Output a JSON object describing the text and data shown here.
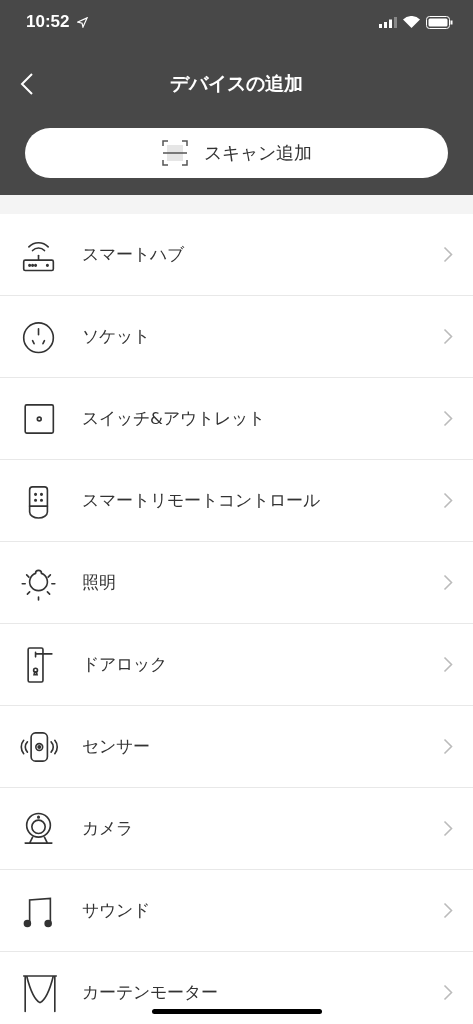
{
  "status_bar": {
    "time": "10:52"
  },
  "nav": {
    "title": "デバイスの追加"
  },
  "scan_button": {
    "label": "スキャン追加"
  },
  "items": [
    {
      "kind": "hub",
      "label": "スマートハブ"
    },
    {
      "kind": "socket",
      "label": "ソケット"
    },
    {
      "kind": "switch",
      "label": "スイッチ&アウトレット"
    },
    {
      "kind": "remote",
      "label": "スマートリモートコントロール"
    },
    {
      "kind": "light",
      "label": "照明"
    },
    {
      "kind": "lock",
      "label": "ドアロック"
    },
    {
      "kind": "sensor",
      "label": "センサー"
    },
    {
      "kind": "camera",
      "label": "カメラ"
    },
    {
      "kind": "sound",
      "label": "サウンド"
    },
    {
      "kind": "curtain",
      "label": "カーテンモーター"
    }
  ]
}
